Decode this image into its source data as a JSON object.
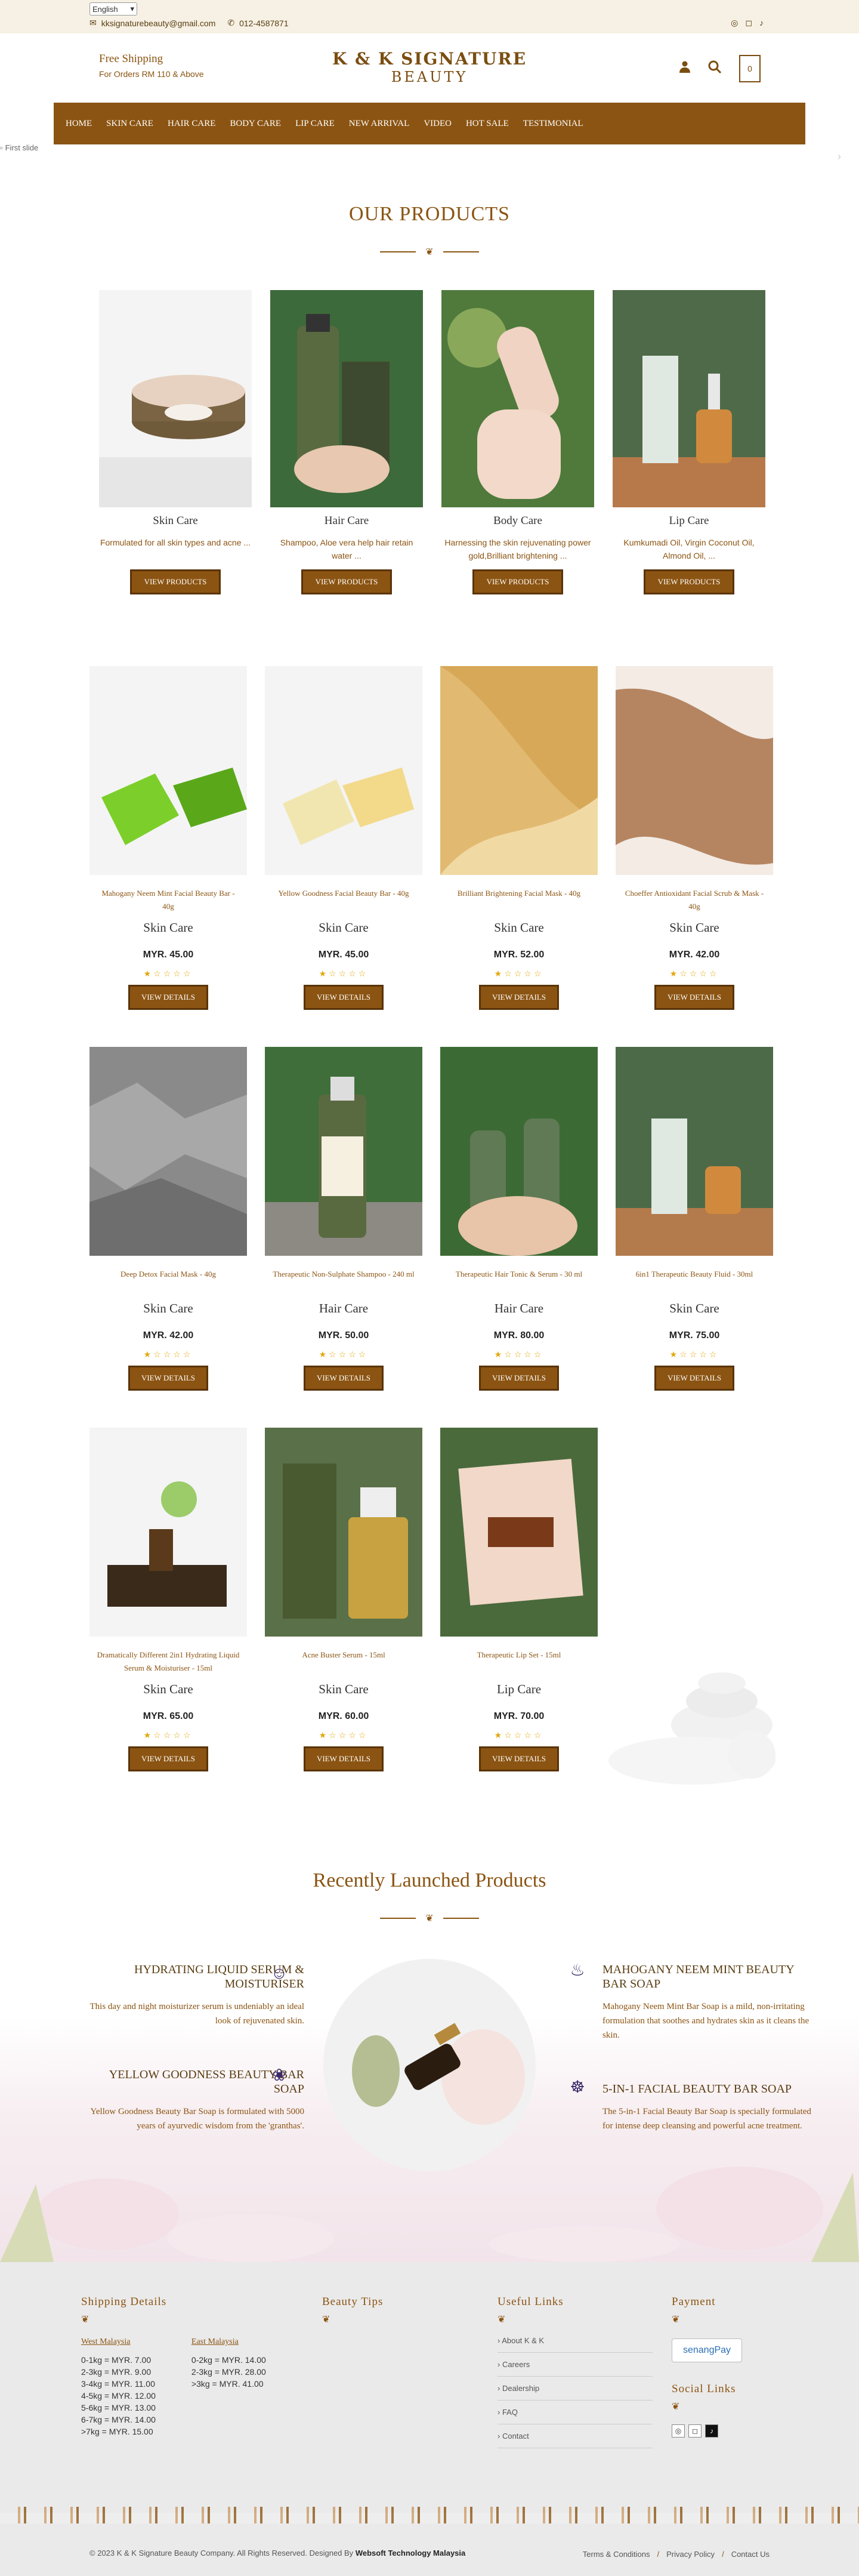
{
  "topbar": {
    "language": "English",
    "email": "kksignaturebeauty@gmail.com",
    "phone": "012-4587871"
  },
  "header": {
    "shipping_title": "Free Shipping",
    "shipping_sub": "For Orders RM 110 & Above",
    "logo_line1": "K & K SIGNATURE",
    "logo_line2": "BEAUTY",
    "cart_count": "0"
  },
  "nav": [
    "HOME",
    "SKIN CARE",
    "HAIR CARE",
    "BODY CARE",
    "LIP CARE",
    "NEW ARRIVAL",
    "VIDEO",
    "HOT SALE",
    "TESTIMONIAL"
  ],
  "slider": {
    "alt_text": "First slide"
  },
  "our_products": {
    "title": "OUR PRODUCTS",
    "categories": [
      {
        "title": "Skin Care",
        "desc": "Formulated for all skin types and acne ...",
        "button": "VIEW PRODUCTS"
      },
      {
        "title": "Hair Care",
        "desc": "Shampoo, Aloe vera help hair retain water ...",
        "button": "VIEW PRODUCTS"
      },
      {
        "title": "Body Care",
        "desc": "Harnessing the skin rejuvenating power gold,Brilliant brightening ...",
        "button": "VIEW PRODUCTS"
      },
      {
        "title": "Lip Care",
        "desc": "Kumkumadi Oil, Virgin Coconut Oil, Almond Oil, ...",
        "button": "VIEW PRODUCTS"
      }
    ]
  },
  "products": [
    {
      "name": "Mahogany Neem Mint Facial Beauty Bar - 40g",
      "category": "Skin Care",
      "price": "MYR. 45.00",
      "rating": 1,
      "button": "VIEW DETAILS",
      "img": "green-bar"
    },
    {
      "name": "Yellow Goodness Facial Beauty Bar - 40g",
      "category": "Skin Care",
      "price": "MYR. 45.00",
      "rating": 1,
      "button": "VIEW DETAILS",
      "img": "yellow-bar"
    },
    {
      "name": "Brilliant Brightening Facial Mask - 40g",
      "category": "Skin Care",
      "price": "MYR. 52.00",
      "rating": 1,
      "button": "VIEW DETAILS",
      "img": "gold-mask"
    },
    {
      "name": "Choeffer Antioxidant Facial Scrub & Mask - 40g",
      "category": "Skin Care",
      "price": "MYR. 42.00",
      "rating": 1,
      "button": "VIEW DETAILS",
      "img": "scrub"
    },
    {
      "name": "Deep Detox Facial Mask - 40g",
      "category": "Skin Care",
      "price": "MYR. 42.00",
      "rating": 1,
      "button": "VIEW DETAILS",
      "img": "detox"
    },
    {
      "name": "Therapeutic Non-Sulphate Shampoo - 240 ml",
      "category": "Hair Care",
      "price": "MYR. 50.00",
      "rating": 1,
      "button": "VIEW DETAILS",
      "img": "shampoo"
    },
    {
      "name": "Therapeutic Hair Tonic & Serum - 30 ml",
      "category": "Hair Care",
      "price": "MYR. 80.00",
      "rating": 1,
      "button": "VIEW DETAILS",
      "img": "tonic"
    },
    {
      "name": "6in1 Therapeutic Beauty Fluid - 30ml",
      "category": "Skin Care",
      "price": "MYR. 75.00",
      "rating": 1,
      "button": "VIEW DETAILS",
      "img": "fluid"
    },
    {
      "name": "Dramatically Different 2in1 Hydrating Liquid Serum & Moisturiser - 15ml",
      "category": "Skin Care",
      "price": "MYR. 65.00",
      "rating": 1,
      "button": "VIEW DETAILS",
      "img": "serum"
    },
    {
      "name": "Acne Buster Serum - 15ml",
      "category": "Skin Care",
      "price": "MYR. 60.00",
      "rating": 1,
      "button": "VIEW DETAILS",
      "img": "acne"
    },
    {
      "name": "Therapeutic Lip Set - 15ml",
      "category": "Lip Care",
      "price": "MYR. 70.00",
      "rating": 1,
      "button": "VIEW DETAILS",
      "img": "lipset"
    }
  ],
  "recent": {
    "title": "Recently Launched Products",
    "items": [
      {
        "title": "HYDRATING LIQUID SERUM & MOISTURISER",
        "text": "This day and night moisturizer serum is undeniably an ideal look of rejuvenated skin."
      },
      {
        "title": "YELLOW GOODNESS BEAUTY BAR SOAP",
        "text": "Yellow Goodness Beauty Bar Soap is formulated with 5000 years of ayurvedic wisdom from the 'granthas'."
      },
      {
        "title": "MAHOGANY NEEM MINT BEAUTY BAR SOAP",
        "text": "Mahogany Neem Mint Bar Soap is a mild, non-irritating formulation that soothes and hydrates skin as it cleans the skin."
      },
      {
        "title": "5-IN-1 FACIAL BEAUTY BAR SOAP",
        "text": "The 5-in-1 Facial Beauty Bar Soap is specially formulated for intense deep cleansing and powerful acne treatment."
      }
    ]
  },
  "footer": {
    "shipping_title": "Shipping Details",
    "west_title": "West Malaysia",
    "west_rates": [
      "0-1kg = MYR. 7.00",
      "2-3kg = MYR. 9.00",
      "3-4kg = MYR. 11.00",
      "4-5kg = MYR. 12.00",
      "5-6kg = MYR. 13.00",
      "6-7kg = MYR. 14.00",
      ">7kg = MYR. 15.00"
    ],
    "east_title": "East Malaysia",
    "east_rates": [
      "0-2kg = MYR. 14.00",
      "2-3kg = MYR. 28.00",
      ">3kg = MYR. 41.00"
    ],
    "tips_title": "Beauty Tips",
    "links_title": "Useful Links",
    "links": [
      "About K & K",
      "Careers",
      "Dealership",
      "FAQ",
      "Contact"
    ],
    "payment_title": "Payment",
    "payment_provider": "senangPay",
    "social_title": "Social Links"
  },
  "bottom": {
    "copyright": "© 2023 K & K Signature Beauty Company. All Rights Reserved. Designed By",
    "designer": "Websoft Technology Malaysia",
    "links": [
      "Terms & Conditions",
      "Privacy Policy",
      "Contact Us"
    ]
  },
  "colors": {
    "brand": "#8b5412",
    "topbar": "#f6f1e4",
    "footer": "#eaeaea",
    "star": "#e2a80c"
  }
}
